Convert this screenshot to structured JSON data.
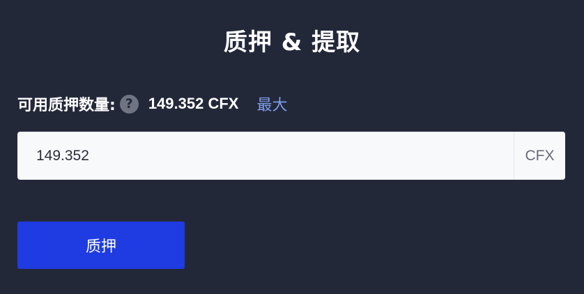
{
  "panel": {
    "title": "质押 & 提取"
  },
  "balance": {
    "label": "可用质押数量:",
    "help_icon": "question-circle-icon",
    "help_glyph": "?",
    "value": "149.352 CFX",
    "max_label": "最大"
  },
  "amount_input": {
    "value": "149.352",
    "unit": "CFX"
  },
  "actions": {
    "stake_label": "质押"
  },
  "colors": {
    "background": "#232839",
    "accent_button": "#1f3be2",
    "link": "#7d9eea",
    "input_background": "#f8f9fb"
  }
}
